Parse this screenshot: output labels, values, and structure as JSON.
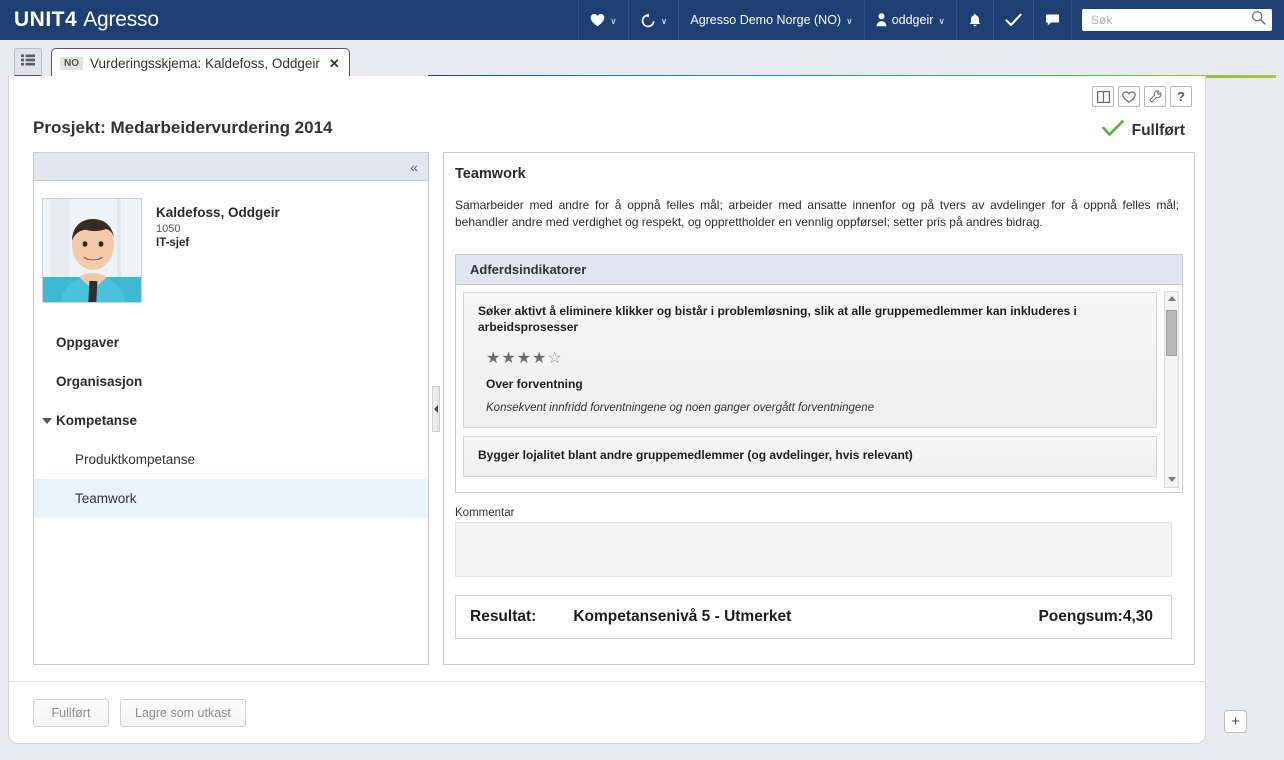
{
  "topbar": {
    "brand_primary": "UNIT4",
    "brand_secondary": "Agresso",
    "background": "#1d3f74",
    "items": [
      {
        "icon": "heart-icon",
        "label": "",
        "caret": "∨"
      },
      {
        "icon": "history-icon",
        "label": "",
        "caret": "∨"
      },
      {
        "icon": "",
        "label": "Agresso Demo Norge (NO)",
        "caret": "∨"
      },
      {
        "icon": "user-icon",
        "label": "oddgeir",
        "caret": "∨"
      },
      {
        "icon": "bell-icon",
        "label": "",
        "caret": ""
      },
      {
        "icon": "checkmark-icon",
        "label": "",
        "caret": ""
      },
      {
        "icon": "chat-icon",
        "label": "",
        "caret": ""
      }
    ],
    "search": {
      "placeholder": "Søk",
      "value": "",
      "icon": "search-icon"
    }
  },
  "tabstrip": {
    "menu_icon": "menu-list-icon",
    "tab": {
      "lang_badge": "NO",
      "title": "Vurderingsskjema: Kaldefoss, Oddgeir",
      "close": "✕"
    },
    "accent_color": "#6b3f8e"
  },
  "page_tools": [
    {
      "name": "split-view-icon"
    },
    {
      "name": "favourite-heart-icon"
    },
    {
      "name": "wrench-icon"
    },
    {
      "name": "help-icon",
      "label": "?"
    }
  ],
  "page": {
    "title": "Prosjekt: Medarbeidervurdering 2014",
    "status": {
      "label": "Fullført",
      "icon": "green-check-icon",
      "color": "#5cb33d"
    }
  },
  "left_pane": {
    "collapse_icon": "double-chevron-left-icon",
    "person": {
      "avatar": "employee-photo",
      "name": "Kaldefoss, Oddgeir",
      "id": "1050",
      "role": "IT-sjef"
    },
    "nav": [
      {
        "label": "Oppgaver",
        "level": "top",
        "expandable": false,
        "selected": false
      },
      {
        "label": "Organisasjon",
        "level": "top",
        "expandable": false,
        "selected": false
      },
      {
        "label": "Kompetanse",
        "level": "top",
        "expandable": true,
        "selected": false
      },
      {
        "label": "Produktkompetanse",
        "level": "sub",
        "expandable": false,
        "selected": false
      },
      {
        "label": "Teamwork",
        "level": "sub",
        "expandable": false,
        "selected": true
      }
    ]
  },
  "splitter": {
    "icon": "collapse-left-arrow-icon"
  },
  "right_pane": {
    "competency_title": "Teamwork",
    "competency_description": "Samarbeider med andre for å oppnå felles mål; arbeider med ansatte innenfor og på tvers av avdelinger for å oppnå felles mål; behandler andre med verdighet og respekt, og opprettholder en vennlig oppførsel; setter pris på andres bidrag.",
    "panel_title": "Adferdsindikatorer",
    "indicators": [
      {
        "text": "Søker aktivt å eliminere klikker og bistår i problemløsning, slik at alle gruppemedlemmer kan inkluderes i arbeidsprosesser",
        "stars_filled": 4,
        "stars_total": 5,
        "rating_label": "Over forventning",
        "rating_description": "Konsekvent innfridd forventningene og noen ganger overgått forventningene"
      },
      {
        "text": "Bygger lojalitet blant andre gruppemedlemmer (og avdelinger, hvis relevant)",
        "stars_filled": 0,
        "stars_total": 5,
        "rating_label": "",
        "rating_description": ""
      }
    ],
    "scrollbar": {
      "up_icon": "scroll-up-arrow-icon",
      "down_icon": "scroll-down-arrow-icon"
    },
    "comment": {
      "label": "Kommentar",
      "value": "",
      "placeholder": ""
    },
    "result": {
      "label": "Resultat:",
      "value": "Kompetansenivå 5 - Utmerket",
      "score_label": "Poengsum:4,30"
    }
  },
  "footer": {
    "buttons": [
      {
        "label": "Fullført"
      },
      {
        "label": "Lagre som utkast"
      }
    ],
    "fab": {
      "label": "+",
      "icon": "plus-icon"
    }
  }
}
